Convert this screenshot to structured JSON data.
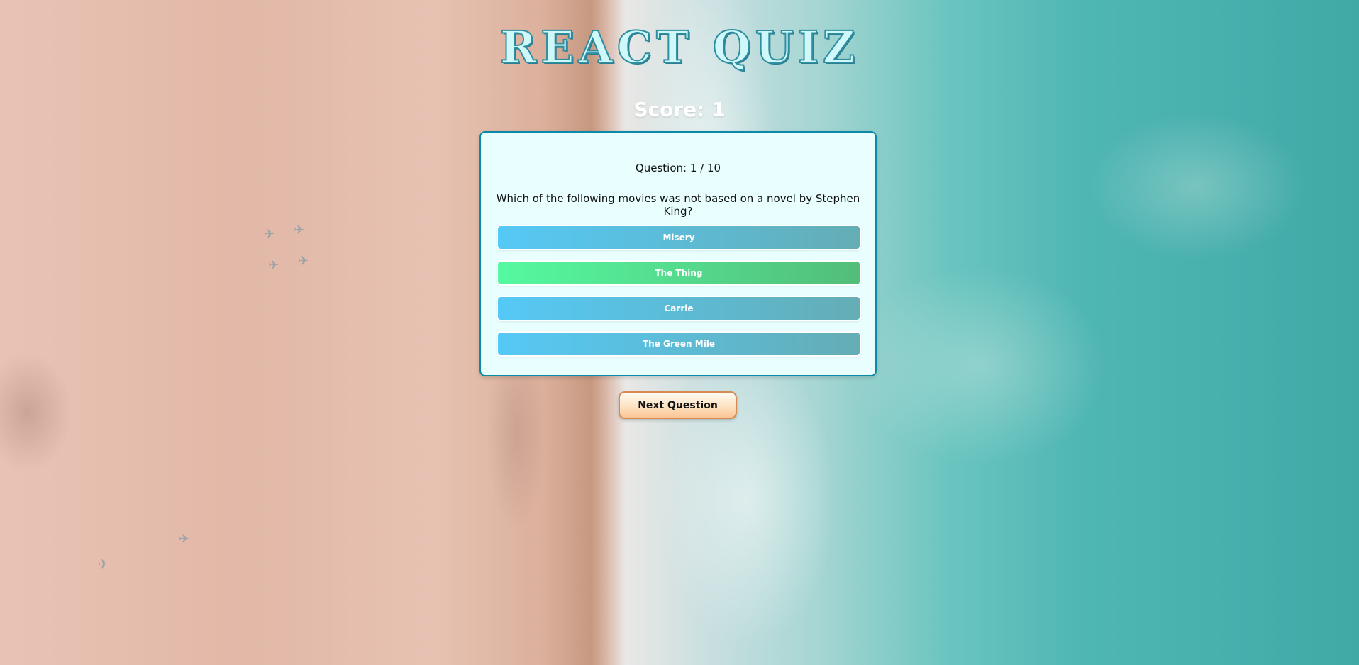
{
  "app": {
    "title": "REACT QUIZ",
    "score_text": "Score: 1"
  },
  "quiz": {
    "question_number": "Question: 1 / 10",
    "question": "Which of the following movies was not based on a novel by Stephen King?",
    "answers": [
      {
        "label": "Misery",
        "state": "default"
      },
      {
        "label": "The Thing",
        "state": "correct"
      },
      {
        "label": "Carrie",
        "state": "default"
      },
      {
        "label": "The Green Mile",
        "state": "default"
      }
    ]
  },
  "controls": {
    "next_label": "Next Question"
  },
  "colors": {
    "card_background": "#e8feff",
    "card_border": "#0a8aa8",
    "answer_gradient": [
      "#55c9f6",
      "#64adb5"
    ],
    "correct_gradient": [
      "#54f9a0",
      "#53bd7a"
    ],
    "next_button_border": "#d98a52",
    "title_fill": "#cff8fa",
    "title_outline": "#2f8ea0"
  },
  "background": {
    "description_icon": "beach-ocean-aerial-image"
  }
}
